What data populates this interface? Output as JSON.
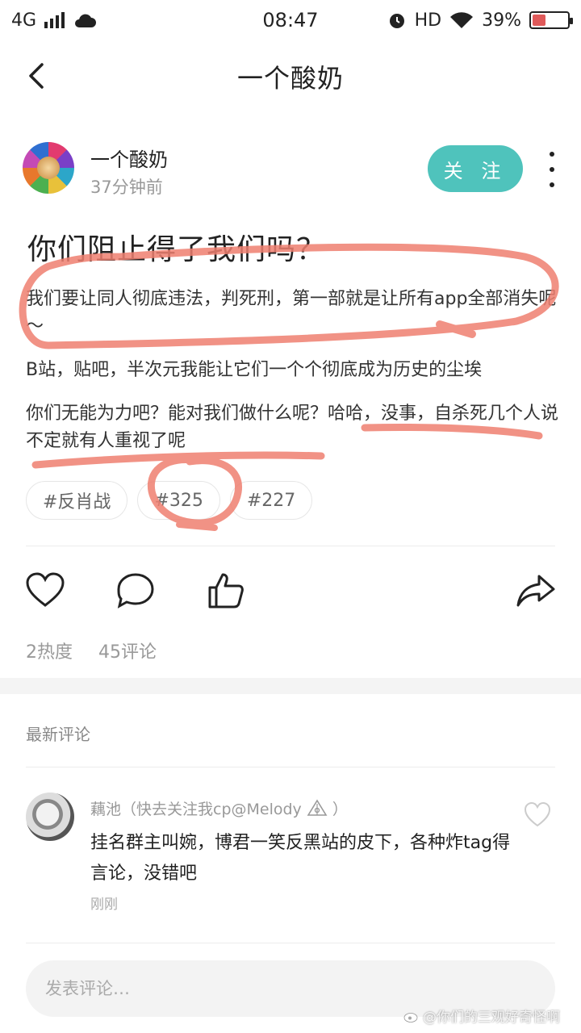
{
  "status_bar": {
    "network": "4G",
    "time": "08:47",
    "hd": "HD",
    "battery_percent": "39%",
    "battery_level": 0.39,
    "battery_color": "#e05a5a"
  },
  "nav": {
    "title": "一个酸奶",
    "back_icon": "chevron-left-icon"
  },
  "post": {
    "author": "一个酸奶",
    "time_ago": "37分钟前",
    "follow_label": "关 注",
    "title": "你们阻止得了我们吗？",
    "paragraphs": [
      "我们要让同人彻底违法，判死刑，第一部就是让所有app全部消失呢～",
      "B站，贴吧，半次元我能让它们一个个彻底成为历史的尘埃",
      "你们无能为力吧？能对我们做什么呢？哈哈，没事，自杀死几个人说不定就有人重视了呢"
    ],
    "tags": [
      "#反肖战",
      "#325",
      "#227"
    ]
  },
  "actions": {
    "like_icon": "heart-icon",
    "comment_icon": "speech-bubble-icon",
    "thumbs_icon": "thumbs-up-icon",
    "share_icon": "share-arrow-icon"
  },
  "stats": {
    "heat": "2热度",
    "comments": "45评论"
  },
  "comments_section": {
    "label": "最新评论",
    "items": [
      {
        "user": "藕池（快去关注我cp@Melody",
        "user_tail": "）",
        "text": "挂名群主叫婉，博君一笑反黑站的皮下，各种炸tag得言论，没错吧",
        "time": "刚刚"
      }
    ]
  },
  "input": {
    "placeholder": "发表评论…"
  },
  "watermark": "@你们的三观好奇怪啊",
  "annotation_color": "#ef7f70"
}
